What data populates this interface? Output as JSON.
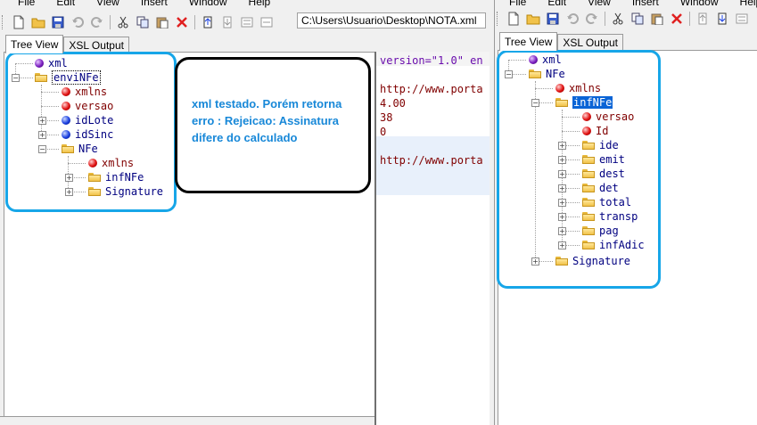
{
  "left": {
    "menu": [
      "File",
      "Edit",
      "View",
      "Insert",
      "Window",
      "Help"
    ],
    "path": "C:\\Users\\Usuario\\Desktop\\NOTA.xml",
    "tabs": [
      "Tree View",
      "XSL Output"
    ],
    "tree": [
      {
        "label": "xml",
        "kind": "purple"
      },
      {
        "label": "enviNFe",
        "kind": "folder"
      },
      {
        "label": "xmlns",
        "kind": "red"
      },
      {
        "label": "versao",
        "kind": "red"
      },
      {
        "label": "idLote",
        "kind": "blue"
      },
      {
        "label": "idSinc",
        "kind": "blue"
      },
      {
        "label": "NFe",
        "kind": "folder"
      },
      {
        "label": "xmlns",
        "kind": "red"
      },
      {
        "label": "infNFe",
        "kind": "folder"
      },
      {
        "label": "Signature",
        "kind": "folder"
      }
    ],
    "values": [
      "version=\"1.0\" en",
      "",
      "http://www.porta",
      "4.00",
      "38",
      "0",
      "",
      "http://www.porta"
    ]
  },
  "callout": {
    "text": "xml testado. Porém retorna erro : Rejeicao: Assinatura difere do calculado"
  },
  "right": {
    "menu": [
      "File",
      "Edit",
      "View",
      "Insert",
      "Window",
      "Help"
    ],
    "tabs": [
      "Tree View",
      "XSL Output"
    ],
    "tree": [
      {
        "label": "xml",
        "kind": "purple"
      },
      {
        "label": "NFe",
        "kind": "folder"
      },
      {
        "label": "xmlns",
        "kind": "red"
      },
      {
        "label": "infNFe",
        "kind": "folder"
      },
      {
        "label": "versao",
        "kind": "red"
      },
      {
        "label": "Id",
        "kind": "red"
      },
      {
        "label": "ide",
        "kind": "folder"
      },
      {
        "label": "emit",
        "kind": "folder"
      },
      {
        "label": "dest",
        "kind": "folder"
      },
      {
        "label": "det",
        "kind": "folder"
      },
      {
        "label": "total",
        "kind": "folder"
      },
      {
        "label": "transp",
        "kind": "folder"
      },
      {
        "label": "pag",
        "kind": "folder"
      },
      {
        "label": "infAdic",
        "kind": "folder"
      },
      {
        "label": "Signature",
        "kind": "folder"
      }
    ]
  },
  "colors": {
    "annotation": "#17a6e8",
    "callout_text": "#1888d8",
    "selection": "#0a64d6"
  }
}
